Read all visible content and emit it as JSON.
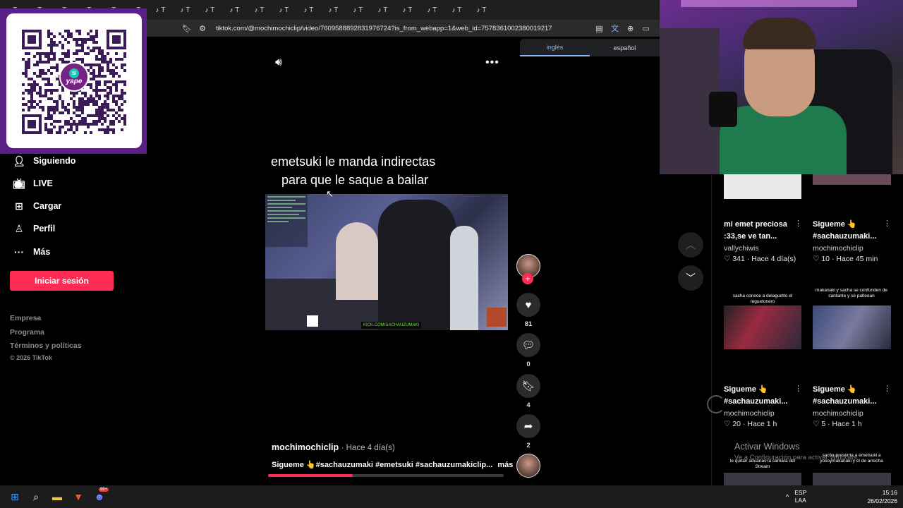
{
  "browser": {
    "tabs": [
      "T",
      "T",
      "T",
      "T",
      "T",
      "T",
      "T",
      "T",
      "T",
      "T",
      "T",
      "T",
      "T",
      "T",
      "T",
      "T",
      "T",
      "T",
      "T",
      "T"
    ],
    "url": "tiktok.com/@mochimochiclip/video/7609588892831976724?is_from_webapp=1&web_id=7578361002380019217",
    "translate": {
      "source": "inglés",
      "target": "español"
    }
  },
  "nav": {
    "items": [
      {
        "label": "Siguiendo",
        "icon": "following-icon"
      },
      {
        "label": "LIVE",
        "icon": "live-icon"
      },
      {
        "label": "Cargar",
        "icon": "upload-icon"
      },
      {
        "label": "Perfil",
        "icon": "profile-icon"
      },
      {
        "label": "Más",
        "icon": "more-icon"
      }
    ],
    "login": "Iniciar sesión",
    "footer": [
      "Empresa",
      "Programa",
      "Términos y políticas"
    ],
    "copyright": "© 2026 TikTok"
  },
  "qr": {
    "brand": "yape",
    "symbol": "S/"
  },
  "video": {
    "caption_line1": "emetsuki le manda indirectas",
    "caption_line2": "para que le saque a bailar",
    "badge": "KICK.COM/SACHAUZUMAKI",
    "author": "mochimochiclip",
    "time": "· Hace 4 día(s)",
    "description": "Sigueme 👆#sachauzumaki #emetsuki #sachauzumakiclip...",
    "more": "más",
    "progress": 0.36,
    "likes": "81",
    "comments": "0",
    "saves": "4",
    "shares": "2"
  },
  "suggestions": [
    {
      "title": "mi emet preciosa :33,se ve tan...",
      "user": "vallychiwis",
      "likes": "341",
      "time": "Hace 4 día(s)"
    },
    {
      "title": "Sigueme 👆 #sachauzumaki...",
      "user": "mochimochiclip",
      "likes": "10",
      "time": "Hace 45 min"
    },
    {
      "title": "Sigueme 👆 #sachauzumaki...",
      "user": "mochimochiclip",
      "likes": "20",
      "time": "Hace 1 h",
      "thumb_caption": "sacha conoce a delaguetto el reguetonero"
    },
    {
      "title": "Sigueme 👆 #sachauzumaki...",
      "user": "mochimochiclip",
      "likes": "5",
      "time": "Hace 1 h",
      "thumb_caption": "makanaki y sacha se confunden de cantante y se palteean"
    }
  ],
  "bottom_thumbs": [
    "le quitan aduanas la camara del Stream",
    "sacha presenta a emetsuki a yosoymakanaki y el de arrecha"
  ],
  "watermark": {
    "title": "Activar Windows",
    "sub": "Ve a Configuración para activar Windows."
  },
  "taskbar": {
    "lang_top": "ESP",
    "lang_bottom": "LAA",
    "time": "15:16",
    "date": "26/02/2026",
    "discord_badge": "99+"
  }
}
